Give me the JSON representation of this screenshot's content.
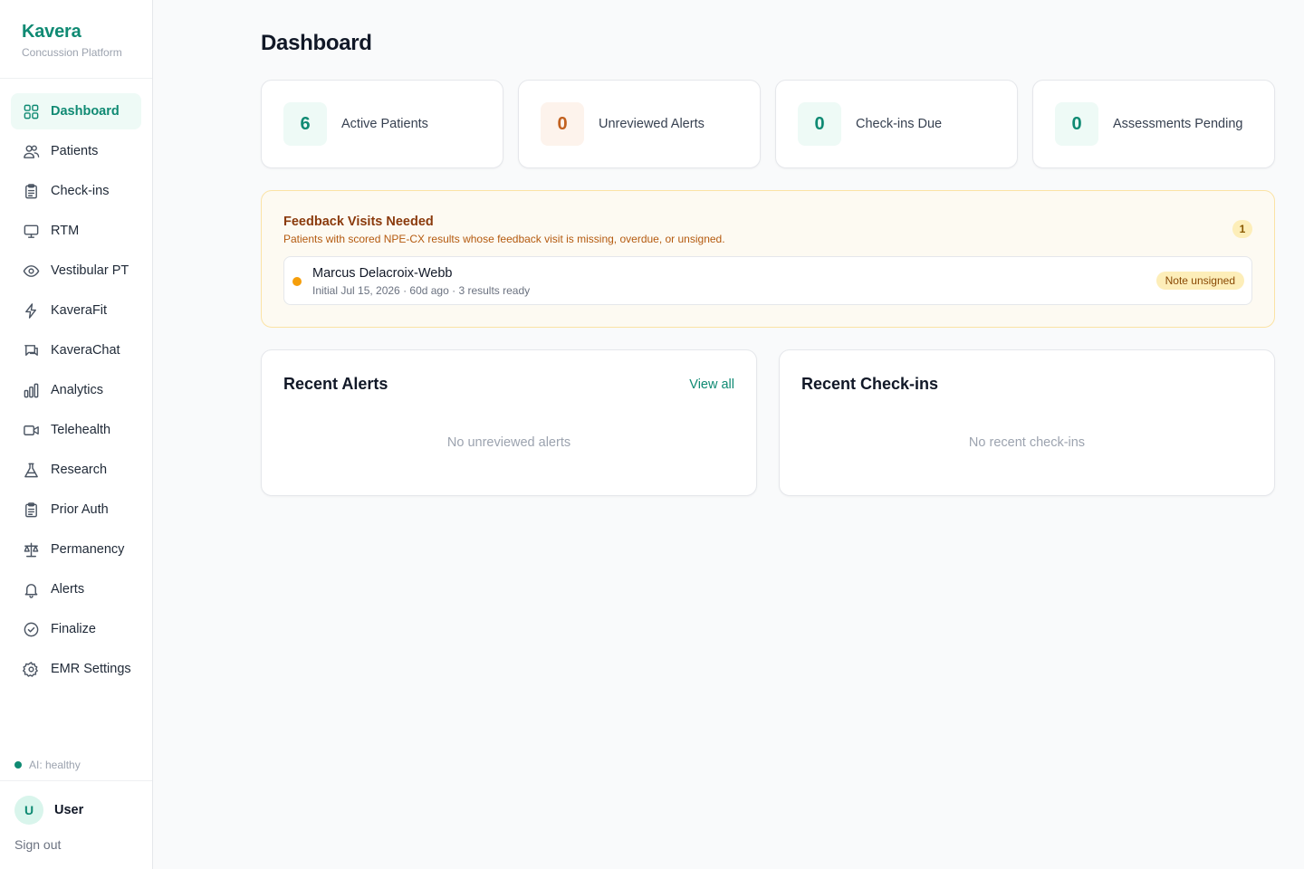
{
  "brand": {
    "name": "Kavera",
    "subtitle": "Concussion Platform"
  },
  "nav": [
    {
      "label": "Dashboard",
      "icon": "grid-icon",
      "active": true
    },
    {
      "label": "Patients",
      "icon": "users-icon"
    },
    {
      "label": "Check-ins",
      "icon": "clipboard-icon"
    },
    {
      "label": "RTM",
      "icon": "monitor-icon"
    },
    {
      "label": "Vestibular PT",
      "icon": "eye-icon"
    },
    {
      "label": "KaveraFit",
      "icon": "lightning-icon"
    },
    {
      "label": "KaveraChat",
      "icon": "chat-icon"
    },
    {
      "label": "Analytics",
      "icon": "bar-chart-icon"
    },
    {
      "label": "Telehealth",
      "icon": "video-icon"
    },
    {
      "label": "Research",
      "icon": "flask-icon"
    },
    {
      "label": "Prior Auth",
      "icon": "clipboard-icon"
    },
    {
      "label": "Permanency",
      "icon": "scale-icon"
    },
    {
      "label": "Alerts",
      "icon": "bell-icon"
    },
    {
      "label": "Finalize",
      "icon": "check-circle-icon"
    },
    {
      "label": "EMR Settings",
      "icon": "gear-icon"
    }
  ],
  "status": {
    "ai": "AI: healthy",
    "ai_color": "#0f8a73"
  },
  "user": {
    "initial": "U",
    "name": "User",
    "sign_out": "Sign out"
  },
  "page": {
    "title": "Dashboard"
  },
  "stats": [
    {
      "value": "6",
      "label": "Active Patients",
      "tone": "teal"
    },
    {
      "value": "0",
      "label": "Unreviewed Alerts",
      "tone": "orange"
    },
    {
      "value": "0",
      "label": "Check-ins Due",
      "tone": "teal"
    },
    {
      "value": "0",
      "label": "Assessments Pending",
      "tone": "teal"
    }
  ],
  "feedback": {
    "title": "Feedback Visits Needed",
    "subtitle": "Patients with scored NPE-CX results whose feedback visit is missing, overdue, or unsigned.",
    "count": "1",
    "items": [
      {
        "name": "Marcus Delacroix-Webb",
        "meta": "Initial Jul 15, 2026 · 60d ago · 3 results ready",
        "badge": "Note unsigned"
      }
    ]
  },
  "recent_alerts": {
    "title": "Recent Alerts",
    "link": "View all",
    "empty": "No unreviewed alerts"
  },
  "recent_checkins": {
    "title": "Recent Check-ins",
    "empty": "No recent check-ins"
  },
  "colors": {
    "accent": "#0f8a73",
    "warning": "#f59e0b",
    "alert_orange": "#c2611f"
  }
}
